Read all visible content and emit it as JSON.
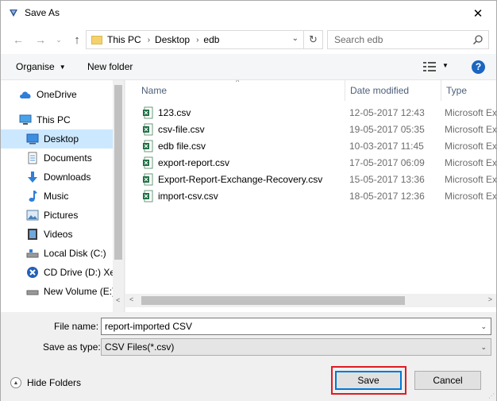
{
  "window": {
    "title": "Save As",
    "close_glyph": "✕"
  },
  "nav": {
    "back_glyph": "←",
    "forward_glyph": "→",
    "recent_glyph": "⌄",
    "up_glyph": "↑",
    "breadcrumb": [
      "This PC",
      "Desktop",
      "edb"
    ],
    "breadcrumb_sep": "›",
    "refresh_glyph": "↻",
    "search_placeholder": "Search edb"
  },
  "toolbar": {
    "organise_label": "Organise",
    "organise_caret": "▼",
    "new_folder_label": "New folder",
    "view_caret": "▼",
    "help_label": "?"
  },
  "sidebar": {
    "items": [
      {
        "label": "OneDrive",
        "icon": "cloud-icon"
      },
      {
        "label": "This PC",
        "icon": "computer-icon"
      },
      {
        "label": "Desktop",
        "icon": "desktop-icon",
        "selected": true
      },
      {
        "label": "Documents",
        "icon": "documents-icon"
      },
      {
        "label": "Downloads",
        "icon": "downloads-icon"
      },
      {
        "label": "Music",
        "icon": "music-icon"
      },
      {
        "label": "Pictures",
        "icon": "pictures-icon"
      },
      {
        "label": "Videos",
        "icon": "videos-icon"
      },
      {
        "label": "Local Disk (C:)",
        "icon": "local-disk-icon"
      },
      {
        "label": "CD Drive (D:) Xen",
        "icon": "cd-drive-icon"
      },
      {
        "label": "New Volume (E:)",
        "icon": "volume-icon"
      }
    ]
  },
  "filelist": {
    "columns": {
      "name": "Name",
      "date": "Date modified",
      "type": "Type"
    },
    "sort_glyph": "^",
    "files": [
      {
        "name": "123.csv",
        "date": "12-05-2017 12:43",
        "type": "Microsoft Ex"
      },
      {
        "name": "csv-file.csv",
        "date": "19-05-2017 05:35",
        "type": "Microsoft Ex"
      },
      {
        "name": "edb file.csv",
        "date": "10-03-2017 11:45",
        "type": "Microsoft Ex"
      },
      {
        "name": "export-report.csv",
        "date": "17-05-2017 06:09",
        "type": "Microsoft Ex"
      },
      {
        "name": "Export-Report-Exchange-Recovery.csv",
        "date": "15-05-2017 13:36",
        "type": "Microsoft Ex"
      },
      {
        "name": "import-csv.csv",
        "date": "18-05-2017 12:36",
        "type": "Microsoft Ex"
      }
    ],
    "scroll_left_glyph": "<",
    "scroll_right_glyph": ">"
  },
  "form": {
    "file_name_label": "File name:",
    "file_name_value": "report-imported CSV",
    "save_type_label": "Save as type:",
    "save_type_value": "CSV Files(*.csv)",
    "drop_glyph": "⌄"
  },
  "footer": {
    "hide_folders_label": "Hide Folders",
    "hide_glyph": "▲",
    "save_label": "Save",
    "cancel_label": "Cancel"
  },
  "colors": {
    "selection": "#cce8ff",
    "accent": "#0078d7",
    "highlight_outline": "#e01b24",
    "excel_green": "#1d7044"
  }
}
